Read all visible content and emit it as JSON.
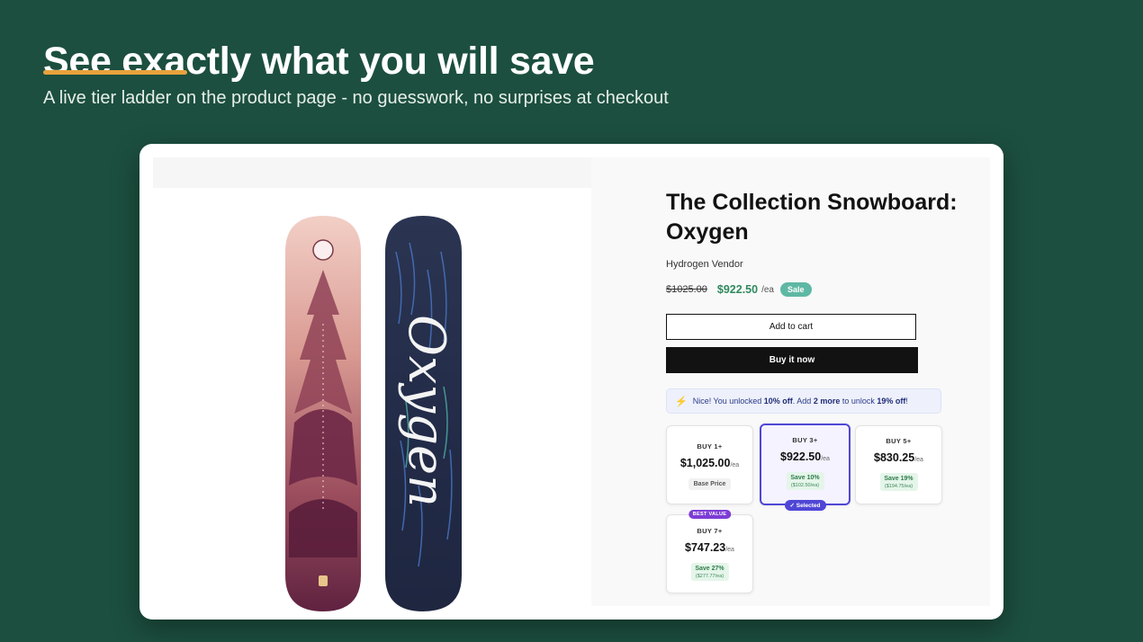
{
  "slide": {
    "headline": "See exactly what you will save",
    "subheadline": "A live tier ladder on the product page - no guesswork, no surprises at checkout"
  },
  "product": {
    "title": "The Collection Snowboard: Oxygen",
    "vendor": "Hydrogen Vendor",
    "compare_price": "$1025.00",
    "sale_price": "$922.50",
    "unit": "/ea",
    "sale_badge": "Sale",
    "add_to_cart": "Add to cart",
    "buy_now": "Buy it now",
    "board_art_text": "Oxygen"
  },
  "unlock_banner": {
    "icon": "lightning-icon",
    "prefix": "Nice! You unlocked ",
    "current_discount": "10% off",
    "mid": ". Add ",
    "more_count": "2 more",
    "mid2": " to unlock ",
    "next_discount": "19% off",
    "suffix": "!"
  },
  "tiers": [
    {
      "label": "BUY 1+",
      "price": "$1,025.00",
      "unit": "/ea",
      "note": "Base Price"
    },
    {
      "label": "BUY 3+",
      "price": "$922.50",
      "unit": "/ea",
      "save": "Save 10%",
      "save_amount": "($102.50/ea)",
      "chip": "✓ Selected"
    },
    {
      "label": "BUY 5+",
      "price": "$830.25",
      "unit": "/ea",
      "save": "Save 19%",
      "save_amount": "($194.75/ea)"
    },
    {
      "label": "BUY 7+",
      "price": "$747.23",
      "unit": "/ea",
      "save": "Save 27%",
      "save_amount": "($277.77/ea)",
      "chip": "BEST VALUE"
    }
  ],
  "colors": {
    "background": "#1c4f3f",
    "accent_underline": "#e8a23c",
    "sale_green": "#2f8a5e",
    "selected_purple": "#5046d6"
  }
}
